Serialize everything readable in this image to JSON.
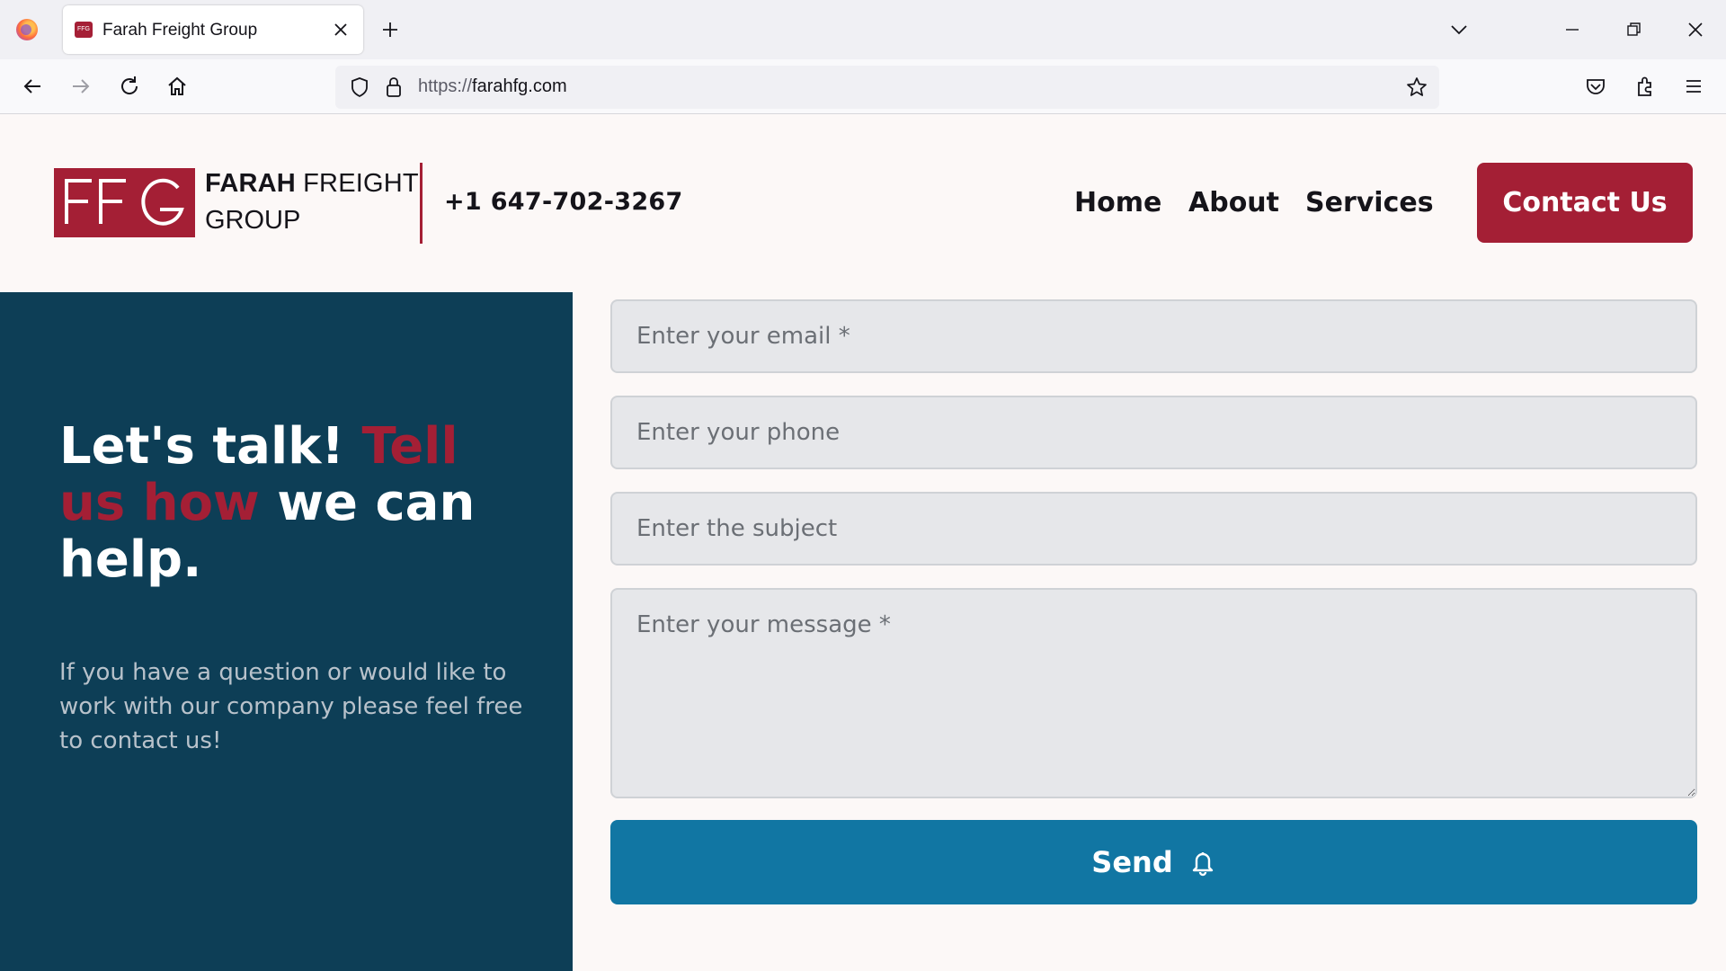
{
  "browser": {
    "tab_title": "Farah Freight Group",
    "tab_favicon_text": "FFG",
    "url_protocol": "https://",
    "url_host": "farahfg.com"
  },
  "header": {
    "logo_text": "FFG",
    "brand_bold": "FARAH",
    "brand_rest": " FREIGHT",
    "brand_line2": "GROUP",
    "phone": "+1 647-702-3267",
    "nav": [
      "Home",
      "About",
      "Services"
    ],
    "cta_label": "Contact Us"
  },
  "hero": {
    "headline_part1": "Let's talk! ",
    "headline_accent": "Tell us how",
    "headline_part2": " we can help.",
    "subtext": "If you have a question or would like to work with our company please feel free to contact us!"
  },
  "form": {
    "email_placeholder": "Enter your email *",
    "phone_placeholder": "Enter your phone",
    "subject_placeholder": "Enter the subject",
    "message_placeholder": "Enter your message *",
    "send_label": "Send"
  },
  "colors": {
    "brand_red": "#a41f35",
    "panel_navy": "#0d3e56",
    "send_blue": "#1176a3"
  },
  "icons": [
    "firefox-icon",
    "close-icon",
    "plus-icon",
    "chevron-down-icon",
    "minimize-icon",
    "restore-icon",
    "back-icon",
    "forward-icon",
    "reload-icon",
    "home-icon",
    "shield-icon",
    "lock-icon",
    "star-icon",
    "pocket-icon",
    "extensions-icon",
    "menu-icon",
    "bell-icon"
  ]
}
